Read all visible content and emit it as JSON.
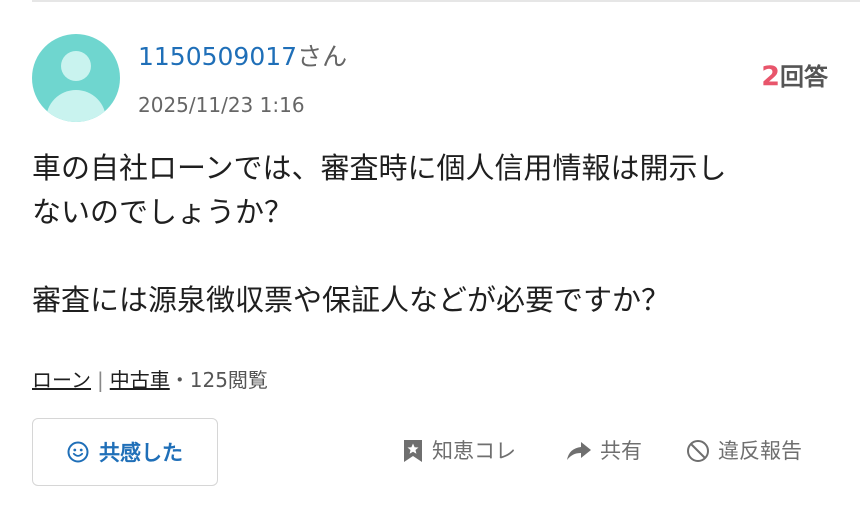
{
  "question": {
    "user_name": "1150509017",
    "user_suffix": "さん",
    "posted_at": "2025/11/23 1:16",
    "answer_count": "2",
    "answer_label": "回答",
    "body_line1": "車の自社ローンでは、審査時に個人信用情報は開示し",
    "body_line2": "ないのでしょうか？",
    "body_line3": "審査には源泉徴収票や保証人などが必要ですか？"
  },
  "tags": {
    "category1": "ローン",
    "separator": "|",
    "category2": "中古車",
    "views": "・125閲覧"
  },
  "actions": {
    "empathy_label": "共感した",
    "chie_label": "知恵コレ",
    "share_label": "共有",
    "report_label": "違反報告"
  },
  "icons": {
    "avatar": "default-user-avatar",
    "empathy": "smile-icon",
    "chie": "bookmark-star-icon",
    "share": "share-arrow-icon",
    "report": "prohibited-icon"
  },
  "colors": {
    "link_blue": "#1f6fb8",
    "answer_count_red": "#e8556b",
    "avatar_teal": "#6fd6cf",
    "muted_gray": "#6f6f6f"
  }
}
